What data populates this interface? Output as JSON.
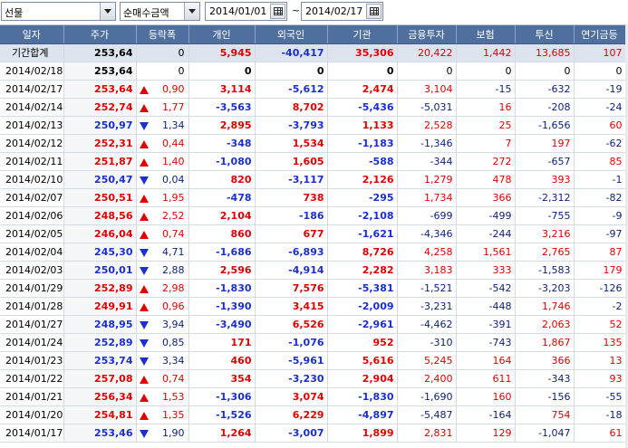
{
  "toolbar": {
    "market_select": "선물",
    "mode_select": "순매수금액",
    "start_date": "2014/01/01",
    "separator": "~",
    "end_date": "2014/02/17"
  },
  "columns": [
    "일자",
    "주가",
    "등락폭",
    "개인",
    "외국인",
    "기관",
    "금융투자",
    "보험",
    "투신",
    "연기금등"
  ],
  "summary": {
    "label": "기간합계",
    "price": "253,64",
    "chg": "0",
    "dir": "",
    "indiv": "5,945",
    "foreign": "-40,417",
    "inst": "35,306",
    "fin": "20,422",
    "ins": "1,442",
    "trust": "13,685",
    "pension": "107"
  },
  "rows": [
    {
      "date": "2014/02/18",
      "price": "253,64",
      "dir": "",
      "chg": "0",
      "indiv": "0",
      "foreign": "0",
      "inst": "0",
      "fin": "0",
      "ins": "0",
      "trust": "0",
      "pension": "0"
    },
    {
      "date": "2014/02/17",
      "price": "253,64",
      "dir": "up",
      "chg": "0,90",
      "indiv": "3,114",
      "foreign": "-5,612",
      "inst": "2,474",
      "fin": "3,104",
      "ins": "-15",
      "trust": "-632",
      "pension": "-19"
    },
    {
      "date": "2014/02/14",
      "price": "252,74",
      "dir": "up",
      "chg": "1,77",
      "indiv": "-3,563",
      "foreign": "8,702",
      "inst": "-5,436",
      "fin": "-5,031",
      "ins": "16",
      "trust": "-208",
      "pension": "-24"
    },
    {
      "date": "2014/02/13",
      "price": "250,97",
      "dir": "down",
      "chg": "1,34",
      "indiv": "2,895",
      "foreign": "-3,793",
      "inst": "1,133",
      "fin": "2,528",
      "ins": "25",
      "trust": "-1,656",
      "pension": "60"
    },
    {
      "date": "2014/02/12",
      "price": "252,31",
      "dir": "up",
      "chg": "0,44",
      "indiv": "-348",
      "foreign": "1,534",
      "inst": "-1,183",
      "fin": "-1,346",
      "ins": "7",
      "trust": "197",
      "pension": "-62"
    },
    {
      "date": "2014/02/11",
      "price": "251,87",
      "dir": "up",
      "chg": "1,40",
      "indiv": "-1,080",
      "foreign": "1,605",
      "inst": "-588",
      "fin": "-344",
      "ins": "272",
      "trust": "-657",
      "pension": "85"
    },
    {
      "date": "2014/02/10",
      "price": "250,47",
      "dir": "down",
      "chg": "0,04",
      "indiv": "820",
      "foreign": "-3,117",
      "inst": "2,126",
      "fin": "1,279",
      "ins": "478",
      "trust": "393",
      "pension": "-1"
    },
    {
      "date": "2014/02/07",
      "price": "250,51",
      "dir": "up",
      "chg": "1,95",
      "indiv": "-478",
      "foreign": "738",
      "inst": "-295",
      "fin": "1,734",
      "ins": "366",
      "trust": "-2,312",
      "pension": "-82"
    },
    {
      "date": "2014/02/06",
      "price": "248,56",
      "dir": "up",
      "chg": "2,52",
      "indiv": "2,104",
      "foreign": "-186",
      "inst": "-2,108",
      "fin": "-699",
      "ins": "-499",
      "trust": "-755",
      "pension": "-9"
    },
    {
      "date": "2014/02/05",
      "price": "246,04",
      "dir": "up",
      "chg": "0,74",
      "indiv": "860",
      "foreign": "677",
      "inst": "-1,621",
      "fin": "-4,346",
      "ins": "-244",
      "trust": "3,216",
      "pension": "-97"
    },
    {
      "date": "2014/02/04",
      "price": "245,30",
      "dir": "down",
      "chg": "4,71",
      "indiv": "-1,686",
      "foreign": "-6,893",
      "inst": "8,726",
      "fin": "4,258",
      "ins": "1,561",
      "trust": "2,765",
      "pension": "87"
    },
    {
      "date": "2014/02/03",
      "price": "250,01",
      "dir": "down",
      "chg": "2,88",
      "indiv": "2,596",
      "foreign": "-4,914",
      "inst": "2,282",
      "fin": "3,183",
      "ins": "333",
      "trust": "-1,583",
      "pension": "179"
    },
    {
      "date": "2014/01/29",
      "price": "252,89",
      "dir": "up",
      "chg": "2,98",
      "indiv": "-1,830",
      "foreign": "7,576",
      "inst": "-5,381",
      "fin": "-1,521",
      "ins": "-542",
      "trust": "-3,203",
      "pension": "-126"
    },
    {
      "date": "2014/01/28",
      "price": "249,91",
      "dir": "up",
      "chg": "0,96",
      "indiv": "-1,390",
      "foreign": "3,415",
      "inst": "-2,009",
      "fin": "-3,231",
      "ins": "-448",
      "trust": "1,746",
      "pension": "-2"
    },
    {
      "date": "2014/01/27",
      "price": "248,95",
      "dir": "down",
      "chg": "3,94",
      "indiv": "-3,490",
      "foreign": "6,526",
      "inst": "-2,961",
      "fin": "-4,462",
      "ins": "-391",
      "trust": "2,063",
      "pension": "52"
    },
    {
      "date": "2014/01/24",
      "price": "252,89",
      "dir": "down",
      "chg": "0,85",
      "indiv": "171",
      "foreign": "-1,076",
      "inst": "952",
      "fin": "-310",
      "ins": "-743",
      "trust": "1,867",
      "pension": "135"
    },
    {
      "date": "2014/01/23",
      "price": "253,74",
      "dir": "down",
      "chg": "3,34",
      "indiv": "460",
      "foreign": "-5,961",
      "inst": "5,616",
      "fin": "5,245",
      "ins": "164",
      "trust": "366",
      "pension": "13"
    },
    {
      "date": "2014/01/22",
      "price": "257,08",
      "dir": "up",
      "chg": "0,74",
      "indiv": "354",
      "foreign": "-3,230",
      "inst": "2,904",
      "fin": "2,400",
      "ins": "611",
      "trust": "-343",
      "pension": "93"
    },
    {
      "date": "2014/01/21",
      "price": "256,34",
      "dir": "up",
      "chg": "1,53",
      "indiv": "-1,306",
      "foreign": "3,074",
      "inst": "-1,830",
      "fin": "-1,690",
      "ins": "160",
      "trust": "-156",
      "pension": "-55"
    },
    {
      "date": "2014/01/20",
      "price": "254,81",
      "dir": "up",
      "chg": "1,35",
      "indiv": "-1,526",
      "foreign": "6,229",
      "inst": "-4,897",
      "fin": "-5,487",
      "ins": "-164",
      "trust": "754",
      "pension": "-18"
    },
    {
      "date": "2014/01/17",
      "price": "253,46",
      "dir": "down",
      "chg": "1,90",
      "indiv": "1,264",
      "foreign": "-3,007",
      "inst": "1,899",
      "fin": "2,831",
      "ins": "129",
      "trust": "-1,047",
      "pension": "61"
    }
  ],
  "colors": {
    "header_bg": "#4f6f9f",
    "up": "#e00000",
    "down": "#1a2fd0",
    "summary_bg": "#dde4ee"
  }
}
